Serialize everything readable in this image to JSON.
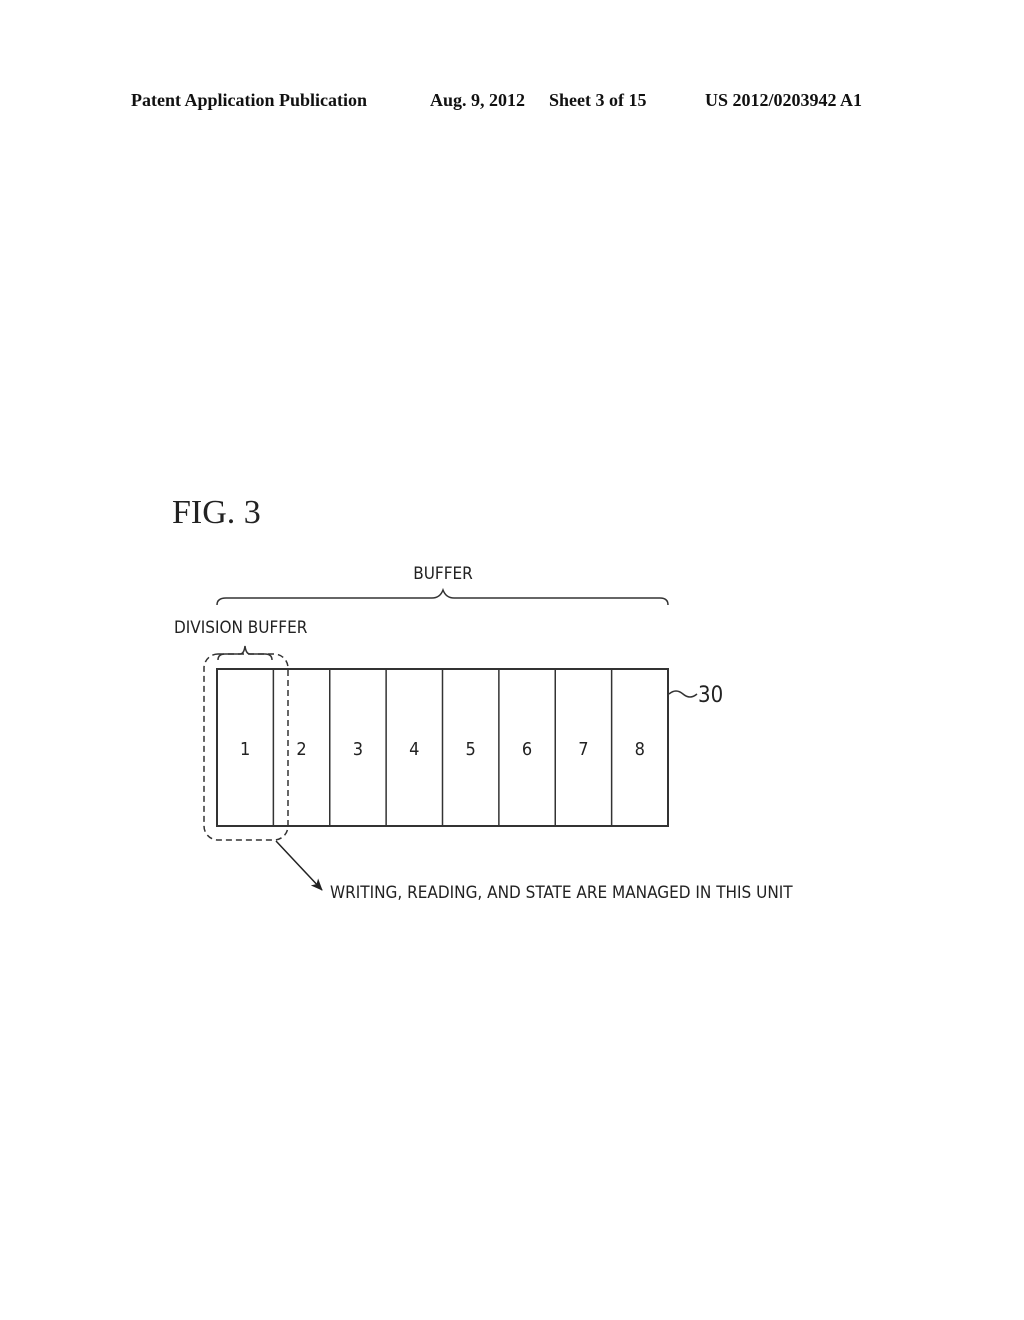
{
  "header": {
    "publication": "Patent Application Publication",
    "date": "Aug. 9, 2012",
    "sheet": "Sheet 3 of 15",
    "patent_number": "US 2012/0203942 A1"
  },
  "figure": {
    "title": "FIG. 3",
    "buffer_label": "BUFFER",
    "division_buffer_label": "DIVISION BUFFER",
    "reference_numeral": "30",
    "cells": [
      "1",
      "2",
      "3",
      "4",
      "5",
      "6",
      "7",
      "8"
    ],
    "annotation": "WRITING, READING, AND STATE ARE MANAGED IN THIS UNIT"
  }
}
